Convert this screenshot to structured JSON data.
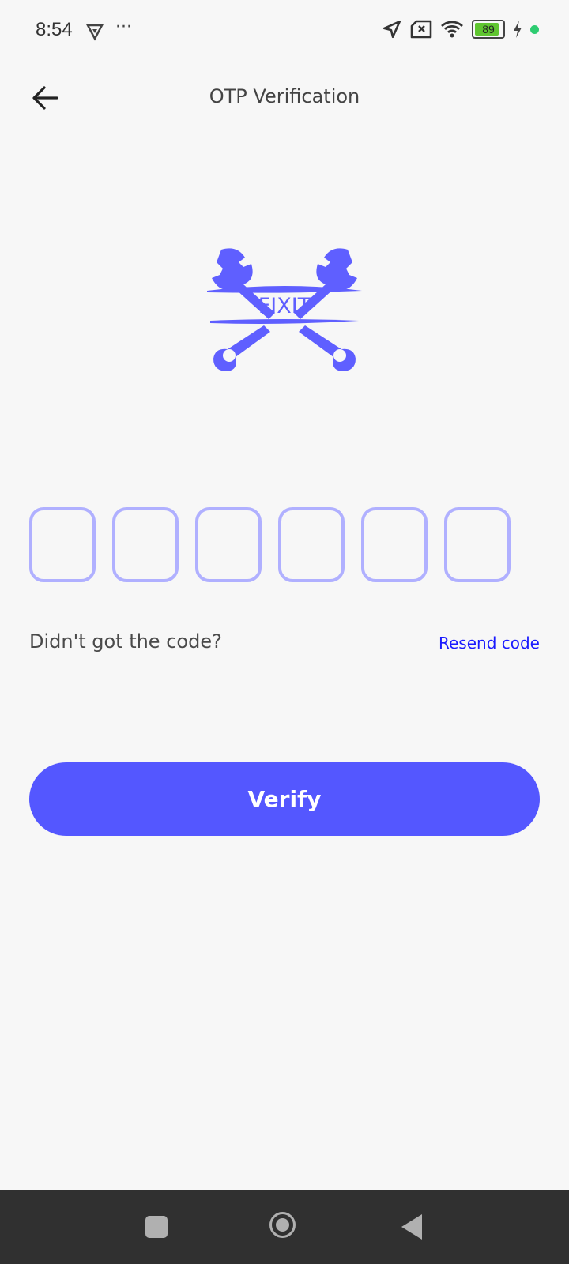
{
  "status_bar": {
    "time": "8:54",
    "more": "···",
    "battery_level": "89",
    "battery_percent": 89,
    "icons": [
      "vpn-shield-icon",
      "location-icon",
      "no-sim-icon",
      "wifi-icon",
      "battery-icon",
      "charging-icon"
    ]
  },
  "header": {
    "title": "OTP Verification",
    "back_icon": "arrow-left-icon"
  },
  "logo": {
    "text": "FIXIT",
    "color": "#5f5fff"
  },
  "otp": {
    "length": 6,
    "values": [
      "",
      "",
      "",
      "",
      "",
      ""
    ]
  },
  "resend": {
    "prompt": "Didn't got the code?",
    "link": "Resend code"
  },
  "verify_button": {
    "label": "Verify",
    "color": "#5457ff"
  },
  "nav_bar": {
    "icons": [
      "recents-icon",
      "home-icon",
      "back-icon"
    ]
  }
}
